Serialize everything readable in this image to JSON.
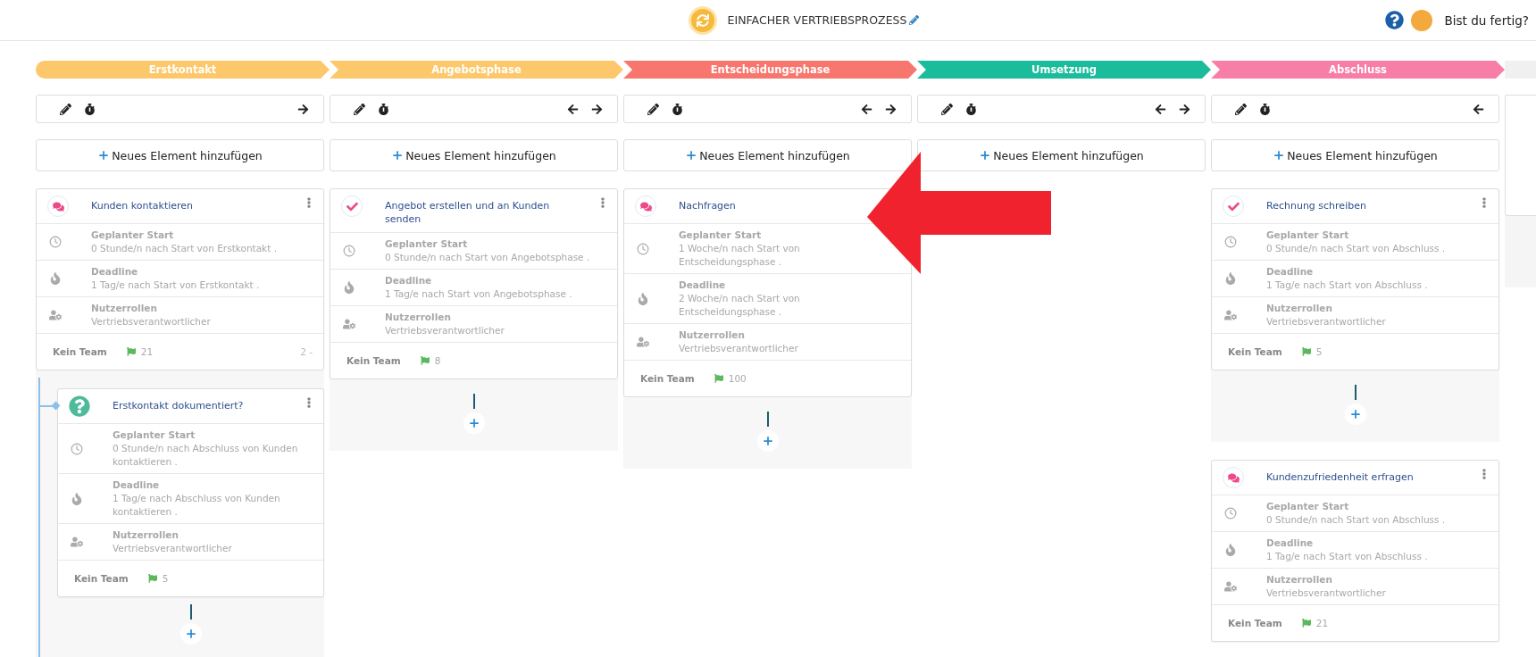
{
  "header": {
    "title": "EINFACHER VERTRIEBSPROZESS",
    "user_prompt": "Bist du fertig?"
  },
  "columns": [
    {
      "phase": "Erstkontakt",
      "color": "#fdc86b",
      "move_left": false,
      "move_right": true,
      "add_label": "Neues Element hinzufügen",
      "cards": [
        {
          "kind": "chat",
          "title": "Kunden kontaktieren",
          "menu": true,
          "rows": [
            {
              "kind": "start",
              "label": "Geplanter Start",
              "value": "0 Stunde/n nach Start von Erstkontakt ."
            },
            {
              "kind": "deadline",
              "label": "Deadline",
              "value": "1 Tag/e nach Start von Erstkontakt ."
            },
            {
              "kind": "roles",
              "label": "Nutzerrollen",
              "value": "Vertriebsverantwortlicher"
            }
          ],
          "team": "Kein Team",
          "flag": "21",
          "extra": "2 -",
          "add_area": true,
          "children": [
            {
              "kind": "question",
              "title": "Erstkontakt dokumentiert?",
              "menu": true,
              "rows": [
                {
                  "kind": "start",
                  "label": "Geplanter Start",
                  "value": "0 Stunde/n nach Abschluss von Kunden kontaktieren ."
                },
                {
                  "kind": "deadline",
                  "label": "Deadline",
                  "value": "1 Tag/e nach Abschluss von Kunden kontaktieren ."
                },
                {
                  "kind": "roles",
                  "label": "Nutzerrollen",
                  "value": "Vertriebsverantwortlicher"
                }
              ],
              "team": "Kein Team",
              "flag": "5"
            }
          ]
        }
      ]
    },
    {
      "phase": "Angebotsphase",
      "color": "#fdc86b",
      "move_left": true,
      "move_right": true,
      "add_label": "Neues Element hinzufügen",
      "cards": [
        {
          "kind": "check",
          "title": "Angebot erstellen und an Kunden senden",
          "menu": true,
          "rows": [
            {
              "kind": "start",
              "label": "Geplanter Start",
              "value": "0 Stunde/n nach Start von Angebotsphase ."
            },
            {
              "kind": "deadline",
              "label": "Deadline",
              "value": "1 Tag/e nach Start von Angebotsphase ."
            },
            {
              "kind": "roles",
              "label": "Nutzerrollen",
              "value": "Vertriebsverantwortlicher"
            }
          ],
          "team": "Kein Team",
          "flag": "8",
          "add_area": true
        }
      ]
    },
    {
      "phase": "Entscheidungsphase",
      "color": "#f7776f",
      "move_left": true,
      "move_right": true,
      "add_label": "Neues Element hinzufügen",
      "cards": [
        {
          "kind": "chat",
          "title": "Nachfragen",
          "rows": [
            {
              "kind": "start",
              "label": "Geplanter Start",
              "value": "1 Woche/n nach Start von Entscheidungsphase ."
            },
            {
              "kind": "deadline",
              "label": "Deadline",
              "value": "2 Woche/n nach Start von Entscheidungsphase ."
            },
            {
              "kind": "roles",
              "label": "Nutzerrollen",
              "value": "Vertriebsverantwortlicher"
            }
          ],
          "team": "Kein Team",
          "flag": "100",
          "add_area": true
        }
      ]
    },
    {
      "phase": "Umsetzung",
      "color": "#1bbc9b",
      "move_left": true,
      "move_right": true,
      "add_label": "Neues Element hinzufügen"
    },
    {
      "phase": "Abschluss",
      "color": "#f77fa7",
      "move_left": true,
      "move_right": false,
      "add_label": "Neues Element hinzufügen",
      "cards": [
        {
          "kind": "check",
          "title": "Rechnung schreiben",
          "menu": true,
          "rows": [
            {
              "kind": "start",
              "label": "Geplanter Start",
              "value": "0 Stunde/n nach Start von Abschluss ."
            },
            {
              "kind": "deadline",
              "label": "Deadline",
              "value": "1 Tag/e nach Start von Abschluss ."
            },
            {
              "kind": "roles",
              "label": "Nutzerrollen",
              "value": "Vertriebsverantwortlicher"
            }
          ],
          "team": "Kein Team",
          "flag": "5",
          "add_area": true
        },
        {
          "kind": "chat",
          "title": "Kundenzufriedenheit erfragen",
          "menu": true,
          "rows": [
            {
              "kind": "start",
              "label": "Geplanter Start",
              "value": "0 Stunde/n nach Start von Abschluss ."
            },
            {
              "kind": "deadline",
              "label": "Deadline",
              "value": "1 Tag/e nach Start von Abschluss ."
            },
            {
              "kind": "roles",
              "label": "Nutzerrollen",
              "value": "Vertriebsverantwortlicher"
            }
          ],
          "team": "Kein Team",
          "flag": "21"
        }
      ]
    }
  ]
}
